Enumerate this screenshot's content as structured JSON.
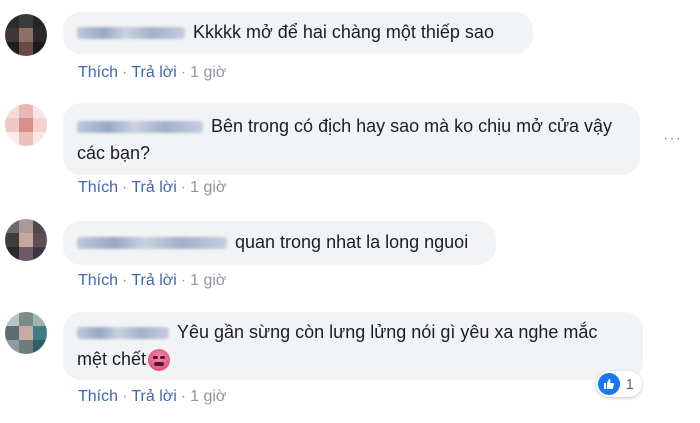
{
  "labels": {
    "like": "Thích",
    "reply": "Trả lời",
    "separator": "·",
    "time": "1 giờ"
  },
  "comments": [
    {
      "text": "Kkkkk mở để hai chàng một thiếp sao",
      "name_blurred": true
    },
    {
      "text": "Bên trong có địch hay sao mà ko chịu mở cửa vậy các bạn?",
      "name_blurred": true,
      "has_more_menu": true
    },
    {
      "text": "quan trong nhat la long nguoi",
      "name_blurred": true
    },
    {
      "text": "Yêu gần sừng còn lưng lửng nói gì yêu xa nghe mắc mệt chết",
      "name_blurred": true,
      "emoji": "tired-face-emoji",
      "reaction": {
        "type": "like",
        "count": "1"
      }
    }
  ],
  "more_menu": "···",
  "colors": {
    "link": "#4267b2",
    "bubble": "#f2f3f5",
    "like_blue": "#1877f2"
  }
}
